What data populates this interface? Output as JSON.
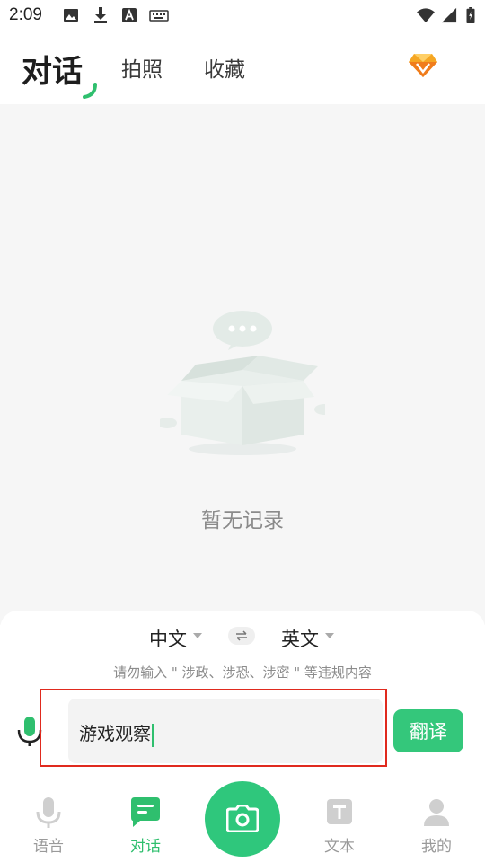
{
  "status_bar": {
    "time": "2:09",
    "left_icons": [
      "image-icon",
      "download-icon",
      "font-icon",
      "keyboard-icon"
    ],
    "right_icons": [
      "wifi-icon",
      "signal-icon",
      "battery-icon"
    ]
  },
  "header": {
    "tabs": [
      {
        "label": "对话",
        "active": true
      },
      {
        "label": "拍照",
        "active": false
      },
      {
        "label": "收藏",
        "active": false
      }
    ],
    "vip_icon": "diamond-icon"
  },
  "main": {
    "empty_text": "暂无记录",
    "empty_icon": "empty-box-icon"
  },
  "panel": {
    "source_lang": "中文",
    "target_lang": "英文",
    "warning": "请勿输入 \" 涉政、涉恐、涉密 \" 等违规内容",
    "input_value": "游戏观察",
    "translate_label": "翻译"
  },
  "bottom_nav": {
    "items": [
      {
        "label": "语音",
        "icon": "mic-icon",
        "active": false
      },
      {
        "label": "对话",
        "icon": "chat-icon",
        "active": true
      },
      {
        "label": "",
        "icon": "camera-icon",
        "active": false
      },
      {
        "label": "文本",
        "icon": "text-icon",
        "active": false
      },
      {
        "label": "我的",
        "icon": "profile-icon",
        "active": false
      }
    ]
  },
  "colors": {
    "accent": "#2fbf6e",
    "highlight": "#e02a1e",
    "main_bg": "#f6f6f6"
  }
}
